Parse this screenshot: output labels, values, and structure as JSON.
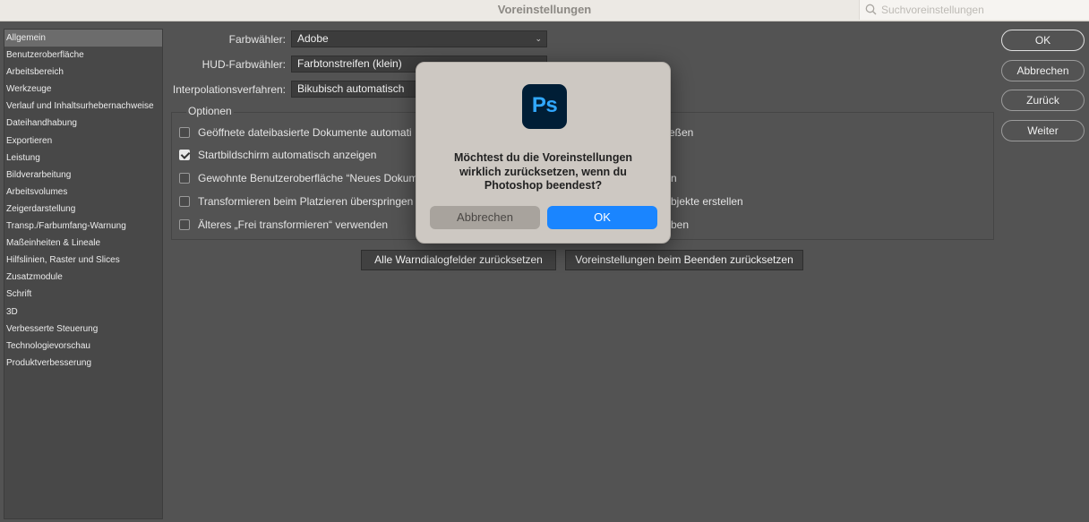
{
  "window": {
    "title": "Voreinstellungen"
  },
  "search": {
    "placeholder": "Suchvoreinstellungen",
    "icon": "search-icon"
  },
  "sidebar": {
    "selected": "Allgemein",
    "items": [
      {
        "label": "Allgemein"
      },
      {
        "label": "Benutzeroberfläche"
      },
      {
        "label": "Arbeitsbereich"
      },
      {
        "label": "Werkzeuge"
      },
      {
        "label": "Verlauf und Inhaltsurhebernachweise"
      },
      {
        "label": "Dateihandhabung"
      },
      {
        "label": "Exportieren"
      },
      {
        "label": "Leistung"
      },
      {
        "label": "Bildverarbeitung"
      },
      {
        "label": "Arbeitsvolumes"
      },
      {
        "label": "Zeigerdarstellung"
      },
      {
        "label": "Transp./Farbumfang-Warnung"
      },
      {
        "label": "Maßeinheiten & Lineale"
      },
      {
        "label": "Hilfslinien, Raster und Slices"
      },
      {
        "label": "Zusatzmodule"
      },
      {
        "label": "Schrift"
      },
      {
        "label": "3D"
      },
      {
        "label": "Verbesserte Steuerung"
      },
      {
        "label": "Technologievorschau"
      },
      {
        "label": "Produktverbesserung"
      }
    ]
  },
  "general": {
    "color_picker": {
      "label": "Farbwähler:",
      "value": "Adobe"
    },
    "hud_color_picker": {
      "label": "HUD-Farbwähler:",
      "value": "Farbtonstreifen (klein)"
    },
    "interpolation": {
      "label": "Interpolationsverfahren:",
      "value": "Bikubisch automatisch"
    },
    "options_title": "Optionen",
    "options_left": [
      {
        "label": "Geöffnete dateibasierte Dokumente automati",
        "checked": false
      },
      {
        "label": "Startbildschirm automatisch anzeigen",
        "checked": true
      },
      {
        "label": "Gewohnte Benutzeroberfläche “Neues Dokum",
        "checked": false
      },
      {
        "label": "Transformieren beim Platzieren überspringen",
        "checked": false
      },
      {
        "label": "Älteres „Frei transformieren“ verwenden",
        "checked": false
      }
    ],
    "options_right_fragments": [
      "hließen",
      "n",
      "n",
      "rtobjekte erstellen",
      "ben"
    ],
    "reset_warnings_button": "Alle Warndialogfelder zurücksetzen",
    "reset_prefs_button": "Voreinstellungen beim Beenden zurücksetzen"
  },
  "right_buttons": {
    "ok": "OK",
    "cancel": "Abbrechen",
    "back": "Zurück",
    "next": "Weiter"
  },
  "dialog": {
    "app_icon_text": "Ps",
    "message": "Möchtest du die Voreinstellungen wirklich zurücksetzen, wenn du Photoshop beendest?",
    "cancel_label": "Abbrechen",
    "ok_label": "OK"
  },
  "colors": {
    "accent": "#1a85ff",
    "ps_icon_bg": "#001e36",
    "ps_icon_fg": "#31a8ff"
  }
}
